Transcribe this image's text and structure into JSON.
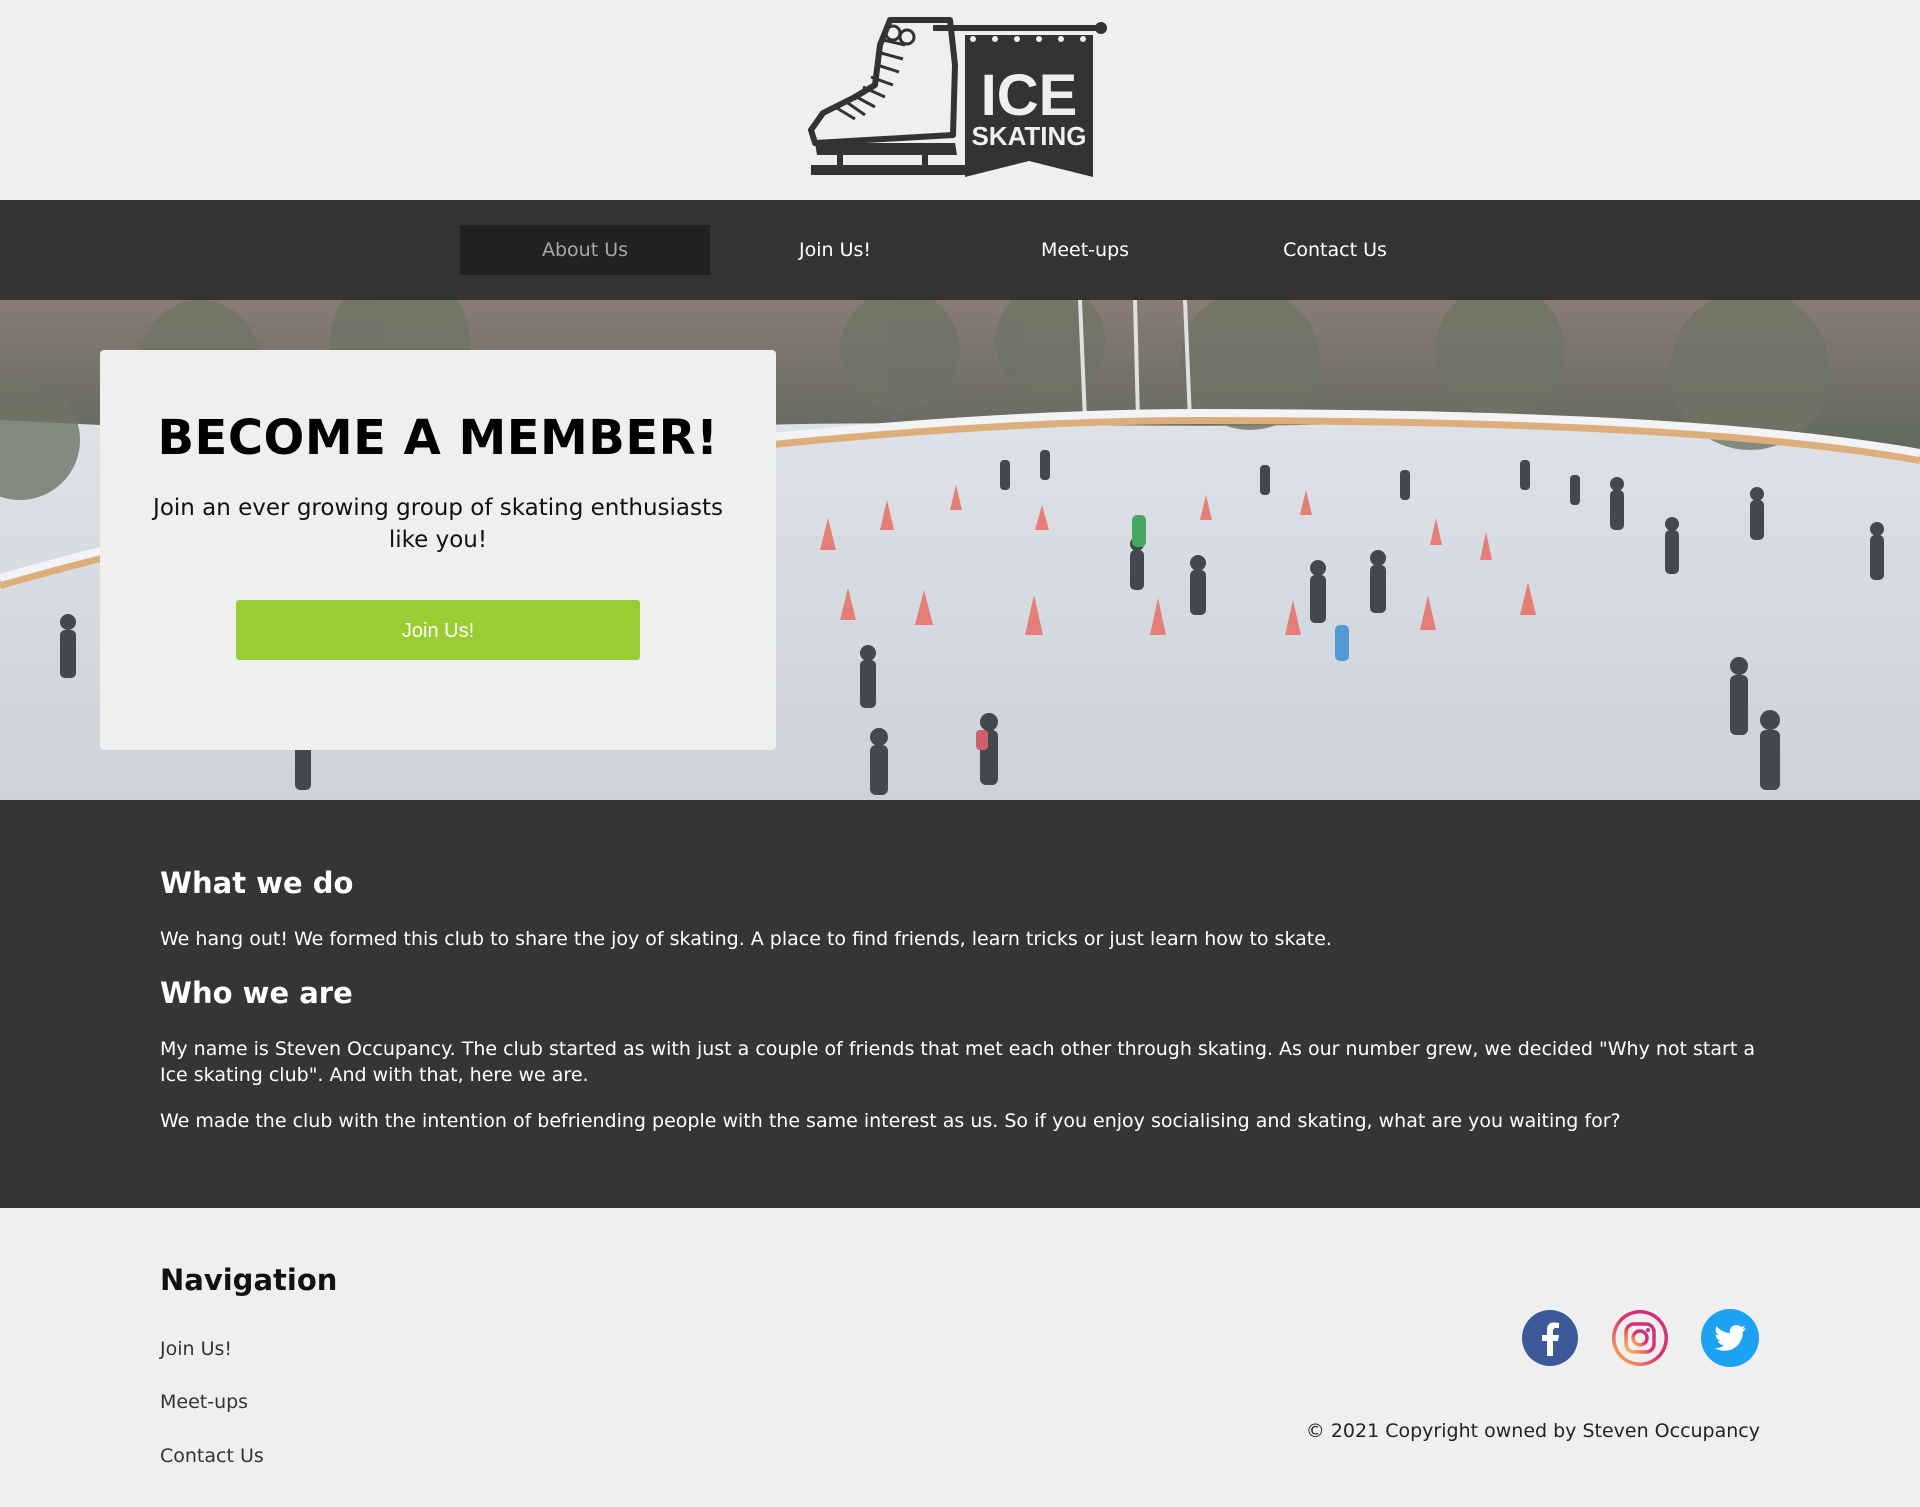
{
  "logo": {
    "line1": "ICE",
    "line2": "SKATING"
  },
  "nav": {
    "items": [
      {
        "label": "About Us",
        "active": true
      },
      {
        "label": "Join Us!",
        "active": false
      },
      {
        "label": "Meet-ups",
        "active": false
      },
      {
        "label": "Contact Us",
        "active": false
      }
    ]
  },
  "hero": {
    "title": "BECOME A MEMBER!",
    "text": "Join an ever growing group of skating enthusiasts like you!",
    "button": "Join Us!"
  },
  "about": {
    "heading1": "What we do",
    "para1": "We hang out! We formed this club to share the joy of skating. A place to find friends, learn tricks or just learn how to skate.",
    "heading2": "Who we are",
    "para2": "My name is Steven Occupancy. The club started as with just a couple of friends that met each other through skating. As our number grew, we decided \"Why not start a Ice skating club\". And with that, here we are.",
    "para3": "We made the club with the intention of befriending people with the same interest as us. So if you enjoy socialising and skating, what are you waiting for?"
  },
  "footer": {
    "heading": "Navigation",
    "links": [
      "Join Us!",
      "Meet-ups",
      "Contact Us"
    ],
    "social": [
      "facebook-icon",
      "instagram-icon",
      "twitter-icon"
    ],
    "copyright": "© 2021 Copyright owned by Steven Occupancy"
  },
  "colors": {
    "nav_bg": "#333333",
    "nav_active_bg": "#222222",
    "button": "#9acd32",
    "about_bg": "#353535",
    "page_bg": "#efefef"
  }
}
